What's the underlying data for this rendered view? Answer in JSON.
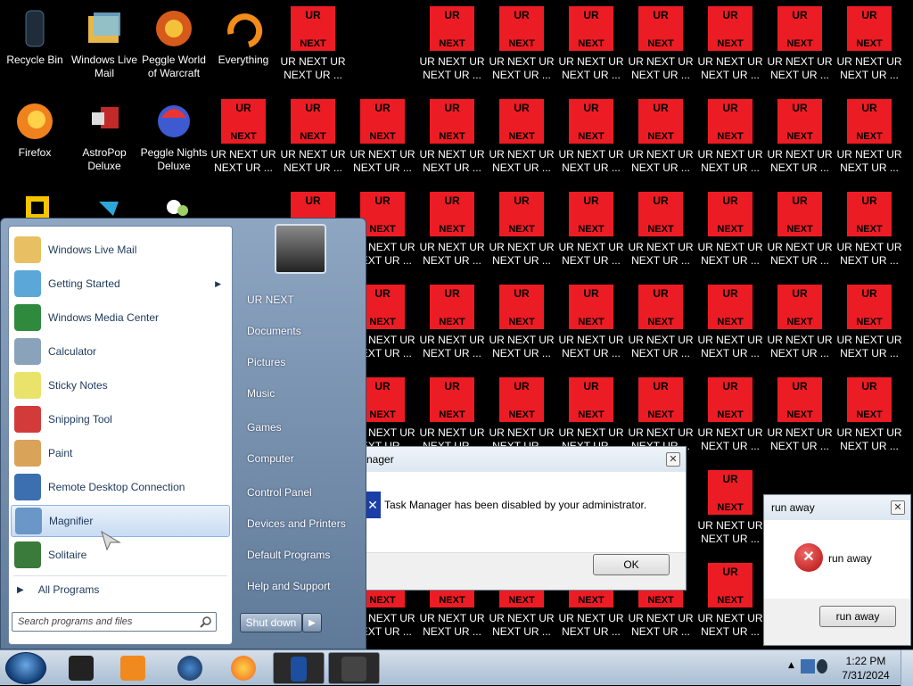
{
  "desktop": {
    "icons": [
      {
        "label": "Recycle Bin",
        "icon": "recycle-bin-icon",
        "color": "#1f2d3b"
      },
      {
        "label": "Windows Live Mail",
        "icon": "windows-live-mail-icon",
        "color": "#e6b84a"
      },
      {
        "label": "Peggle World of Warcraft",
        "icon": "peggle-wow-icon",
        "color": "#d65a1a"
      },
      {
        "label": "Everything",
        "icon": "everything-icon",
        "color": "#f28c1a"
      },
      {
        "label": "Firefox",
        "icon": "firefox-icon",
        "color": "#f0821e"
      },
      {
        "label": "AstroPop Deluxe",
        "icon": "astropop-icon",
        "color": "#c22a2a"
      },
      {
        "label": "Peggle Nights Deluxe",
        "icon": "peggle-nights-icon",
        "color": "#3d5ad1"
      }
    ],
    "ur_icon": {
      "top": "UR",
      "bottom": "NEXT",
      "line1": "UR NEXT UR",
      "line2": "NEXT UR ...",
      "color": "#ec1c24"
    }
  },
  "start_menu": {
    "programs": [
      {
        "label": "Windows Live Mail",
        "icon": "windows-live-mail-icon",
        "color": "#e8c063"
      },
      {
        "label": "Getting Started",
        "icon": "getting-started-icon",
        "color": "#5aa7d8",
        "arrow": "▶"
      },
      {
        "label": "Windows Media Center",
        "icon": "media-center-icon",
        "color": "#2f8a3d"
      },
      {
        "label": "Calculator",
        "icon": "calculator-icon",
        "color": "#8aa3bb"
      },
      {
        "label": "Sticky Notes",
        "icon": "sticky-notes-icon",
        "color": "#e9e36b"
      },
      {
        "label": "Snipping Tool",
        "icon": "snipping-tool-icon",
        "color": "#d33b3b"
      },
      {
        "label": "Paint",
        "icon": "paint-icon",
        "color": "#d9a35a"
      },
      {
        "label": "Remote Desktop Connection",
        "icon": "remote-desktop-icon",
        "color": "#3c6fb0"
      },
      {
        "label": "Magnifier",
        "icon": "magnifier-icon",
        "color": "#6a96c8"
      },
      {
        "label": "Solitaire",
        "icon": "solitaire-icon",
        "color": "#3a7a3a"
      }
    ],
    "all_programs": "All Programs",
    "search_placeholder": "Search programs and files",
    "right_items": [
      "UR NEXT",
      "Documents",
      "Pictures",
      "Music",
      "Games",
      "Computer",
      "Control Panel",
      "Devices and Printers",
      "Default Programs",
      "Help and Support"
    ],
    "shutdown": "Shut down"
  },
  "dialog_taskmgr": {
    "title": "nager",
    "message": "Task Manager has been disabled by your administrator.",
    "ok": "OK"
  },
  "dialog_runaway": {
    "title": "run away",
    "message": "run away",
    "button": "run away"
  },
  "taskbar": {
    "time": "1:22 PM",
    "date": "7/31/2024"
  }
}
